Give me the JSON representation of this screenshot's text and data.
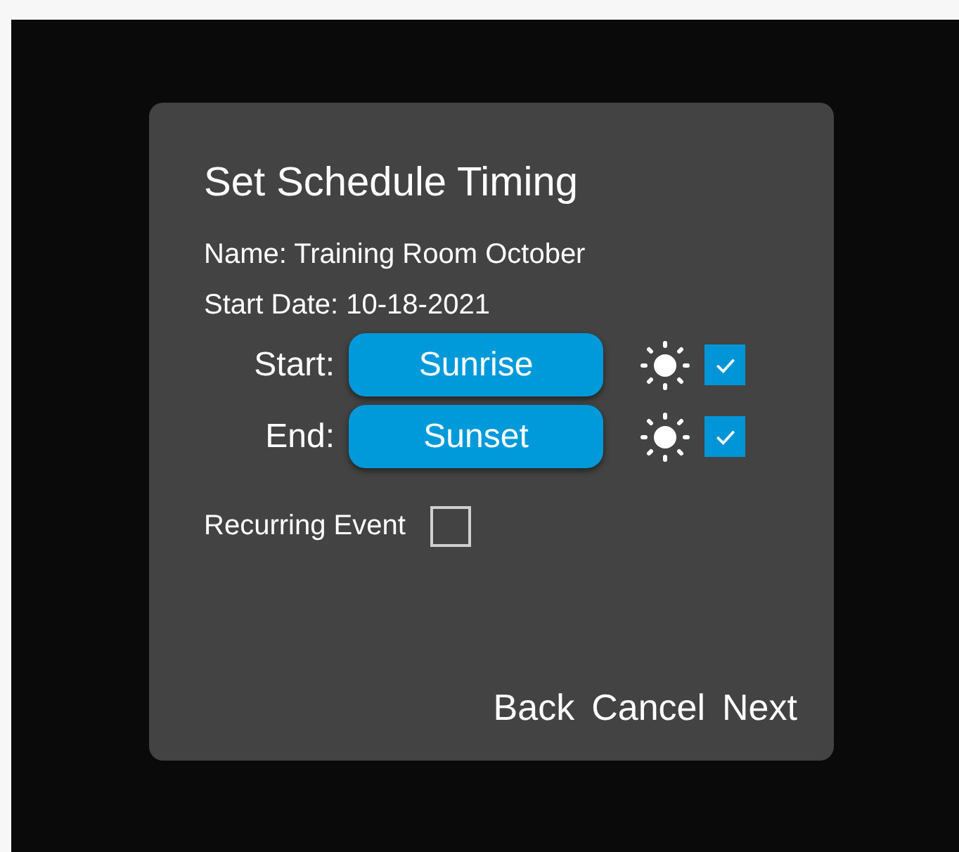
{
  "dialog": {
    "title": "Set Schedule Timing",
    "name_line": "Name: Training Room October",
    "date_line": "Start Date: 10-18-2021",
    "times": [
      {
        "label": "Start:",
        "value": "Sunrise",
        "checked": true
      },
      {
        "label": "End:",
        "value": "Sunset",
        "checked": true
      }
    ],
    "recurring": {
      "label": "Recurring Event",
      "checked": false
    },
    "buttons": [
      "Back",
      "Cancel",
      "Next"
    ]
  }
}
